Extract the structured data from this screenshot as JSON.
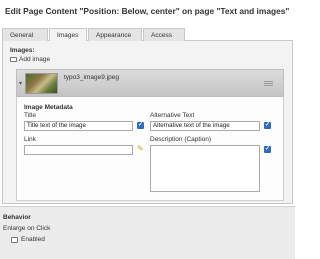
{
  "header": {
    "title": "Edit Page Content \"Position: Below, center\" on page \"Text and images\""
  },
  "tabs": [
    {
      "label": "General"
    },
    {
      "label": "Images",
      "active": true
    },
    {
      "label": "Appearance"
    },
    {
      "label": "Access"
    }
  ],
  "images_section": {
    "label": "Images:",
    "add_image": "Add image",
    "item": {
      "filename": "typo3_image9.jpeg"
    },
    "metadata": {
      "title": "Image Metadata",
      "title_label": "Title",
      "title_value": "Title text of the image",
      "alt_label": "Alternative Text",
      "alt_value": "Alternative text of the image",
      "link_label": "Link",
      "link_value": "",
      "description_label": "Description (Caption)",
      "description_value": ""
    }
  },
  "behavior": {
    "label": "Behavior",
    "enlarge_label": "Enlarge on Click",
    "enabled_label": "Enabled",
    "enabled_checked": false
  },
  "icons": {
    "folder": "folder-icon",
    "collapse": "collapse-icon",
    "drag": "drag-handle-icon",
    "check": "check-icon",
    "wizard": "link-wizard-icon",
    "accent": "#2f6bbf"
  }
}
